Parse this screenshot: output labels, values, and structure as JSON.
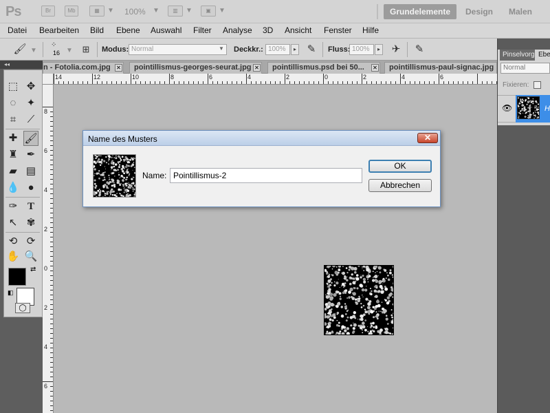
{
  "app": {
    "logo": "Ps",
    "bridge_label": "Br",
    "minibridge_label": "Mb",
    "zoom": "100%",
    "workspaces": {
      "active": "Grundelemente",
      "others": [
        "Design",
        "Malen"
      ]
    }
  },
  "menu": [
    "Datei",
    "Bearbeiten",
    "Bild",
    "Ebene",
    "Auswahl",
    "Filter",
    "Analyse",
    "3D",
    "Ansicht",
    "Fenster",
    "Hilfe"
  ],
  "options": {
    "brush_size": "16",
    "mode_label": "Modus:",
    "mode_value": "Normal",
    "opacity_label": "Deckkr.:",
    "opacity_value": "100%",
    "flow_label": "Fluss:",
    "flow_value": "100%"
  },
  "tabs": [
    {
      "label": "n - Fotolia.com.jpg"
    },
    {
      "label": "pointillismus-georges-seurat.jpg"
    },
    {
      "label": "pointillismus.psd bei 50..."
    },
    {
      "label": "pointillismus-paul-signac.jpg"
    }
  ],
  "ruler": {
    "h": [
      "14",
      "12",
      "10",
      "8",
      "6",
      "4",
      "2",
      "0",
      "2",
      "4",
      "6"
    ],
    "v": [
      "8",
      "6",
      "4",
      "2",
      "0",
      "2",
      "4",
      "6"
    ]
  },
  "right_panel": {
    "tab1": "Pinselvorga",
    "tab2": "Ebe",
    "blend_mode": "Normal",
    "lock_label": "Fixieren:",
    "layer_name": "H"
  },
  "dialog": {
    "title": "Name des Musters",
    "close_symbol": "✕",
    "name_label": "Name:",
    "name_value": "Pointillismus-2",
    "ok_label": "OK",
    "cancel_label": "Abbrechen"
  },
  "colors": {
    "foreground": "#000000",
    "background": "#ffffff",
    "accent": "#3d8ee8"
  }
}
